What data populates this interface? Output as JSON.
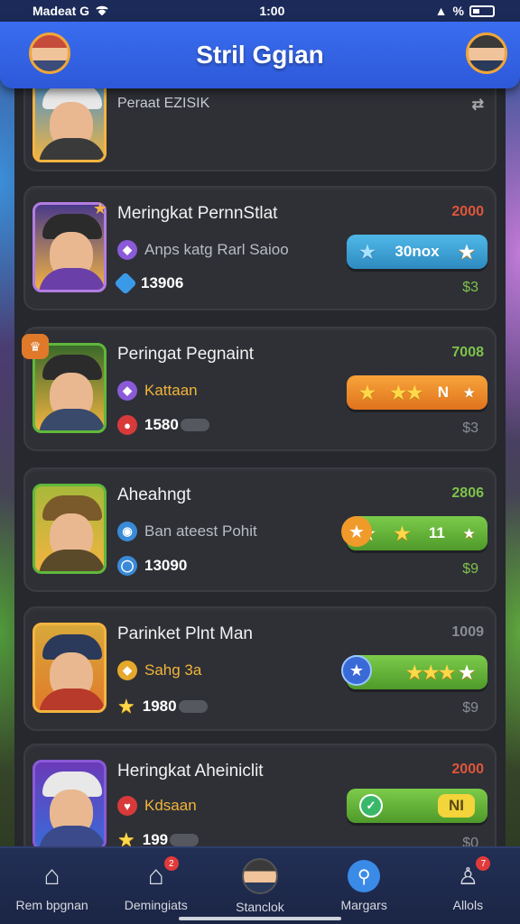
{
  "status_bar": {
    "carrier": "Madeat G",
    "time": "1:00",
    "battery": "%"
  },
  "header": {
    "title": "Stril Ggian"
  },
  "cards": [
    {
      "title": "Peraat EZISIK",
      "sub": "",
      "count": "",
      "value": "",
      "price": "",
      "button": ""
    },
    {
      "title": "Meringkat PernnStlat",
      "sub": "Anps katg Rarl Saioo",
      "count": "13906",
      "value": "2000",
      "value_color": "#e0553a",
      "price": "$3",
      "button": "30nox",
      "button_style": "blue"
    },
    {
      "title": "Peringat Pegnaint",
      "sub": "Kattaan",
      "count": "1580",
      "value": "7008",
      "value_color": "#7fc24a",
      "price": "$3",
      "button": "N",
      "button_style": "orange"
    },
    {
      "title": "Aheahngt",
      "sub": "Ban ateest Pohit",
      "count": "13090",
      "value": "2806",
      "value_color": "#7fc24a",
      "price": "$9",
      "button": "11",
      "button_style": "green"
    },
    {
      "title": "Parinket Plnt Man",
      "sub": "Sahg 3a",
      "count": "1980",
      "value": "1009",
      "value_color": "#8a8d94",
      "price": "$9",
      "button": "",
      "button_style": "green"
    },
    {
      "title": "Heringkat Aheiniclit",
      "sub": "Kdsaan",
      "count": "199",
      "value": "2000",
      "value_color": "#e0553a",
      "price": "$0",
      "button": "NI",
      "button_style": "green-check"
    }
  ],
  "bottom_nav": [
    {
      "label": "Rem bpgnan",
      "icon": "home-icon",
      "badge": ""
    },
    {
      "label": "Demingiats",
      "icon": "house-icon",
      "badge": "2"
    },
    {
      "label": "Stanclok",
      "icon": "avatar-icon",
      "badge": ""
    },
    {
      "label": "Margars",
      "icon": "search-icon",
      "badge": ""
    },
    {
      "label": "Allols",
      "icon": "user-icon",
      "badge": "7"
    }
  ]
}
